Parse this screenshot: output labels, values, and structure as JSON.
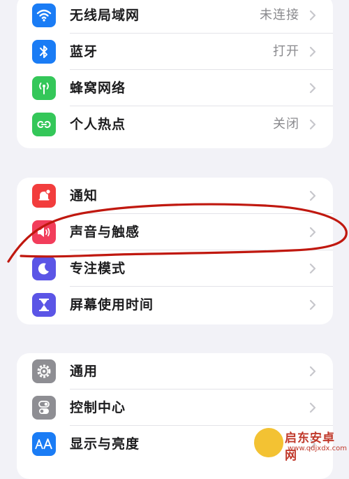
{
  "colors": {
    "page_bg": "#f2f2f7",
    "card_bg": "#ffffff",
    "label": "#1c1c1e",
    "value": "#8a8a8e",
    "chevron": "#c7c7cc",
    "annotation_stroke": "#c0180f"
  },
  "groups": [
    {
      "items": [
        {
          "label": "无线局域网",
          "value": "未连接",
          "icon": "wifi-icon",
          "color": "#1a7cf5"
        },
        {
          "label": "蓝牙",
          "value": "打开",
          "icon": "bluetooth-icon",
          "color": "#1a7cf5"
        },
        {
          "label": "蜂窝网络",
          "value": "",
          "icon": "antenna-icon",
          "color": "#34c759"
        },
        {
          "label": "个人热点",
          "value": "关闭",
          "icon": "hotspot-icon",
          "color": "#34c759"
        }
      ]
    },
    {
      "items": [
        {
          "label": "通知",
          "value": "",
          "icon": "bell-icon",
          "color": "#f23d3d"
        },
        {
          "label": "声音与触感",
          "value": "",
          "icon": "speaker-icon",
          "color": "#f23d5b"
        },
        {
          "label": "专注模式",
          "value": "",
          "icon": "moon-icon",
          "color": "#5b55e6"
        },
        {
          "label": "屏幕使用时间",
          "value": "",
          "icon": "hourglass-icon",
          "color": "#5b55e6"
        }
      ]
    },
    {
      "items": [
        {
          "label": "通用",
          "value": "",
          "icon": "gear-icon",
          "color": "#8e8e93"
        },
        {
          "label": "控制中心",
          "value": "",
          "icon": "toggles-icon",
          "color": "#8e8e93"
        },
        {
          "label": "显示与亮度",
          "value": "",
          "icon": "text-size-icon",
          "color": "#1a7cf5"
        }
      ]
    }
  ],
  "watermark": {
    "title": "启东安卓网",
    "url": "www.qdjxdx.com"
  }
}
